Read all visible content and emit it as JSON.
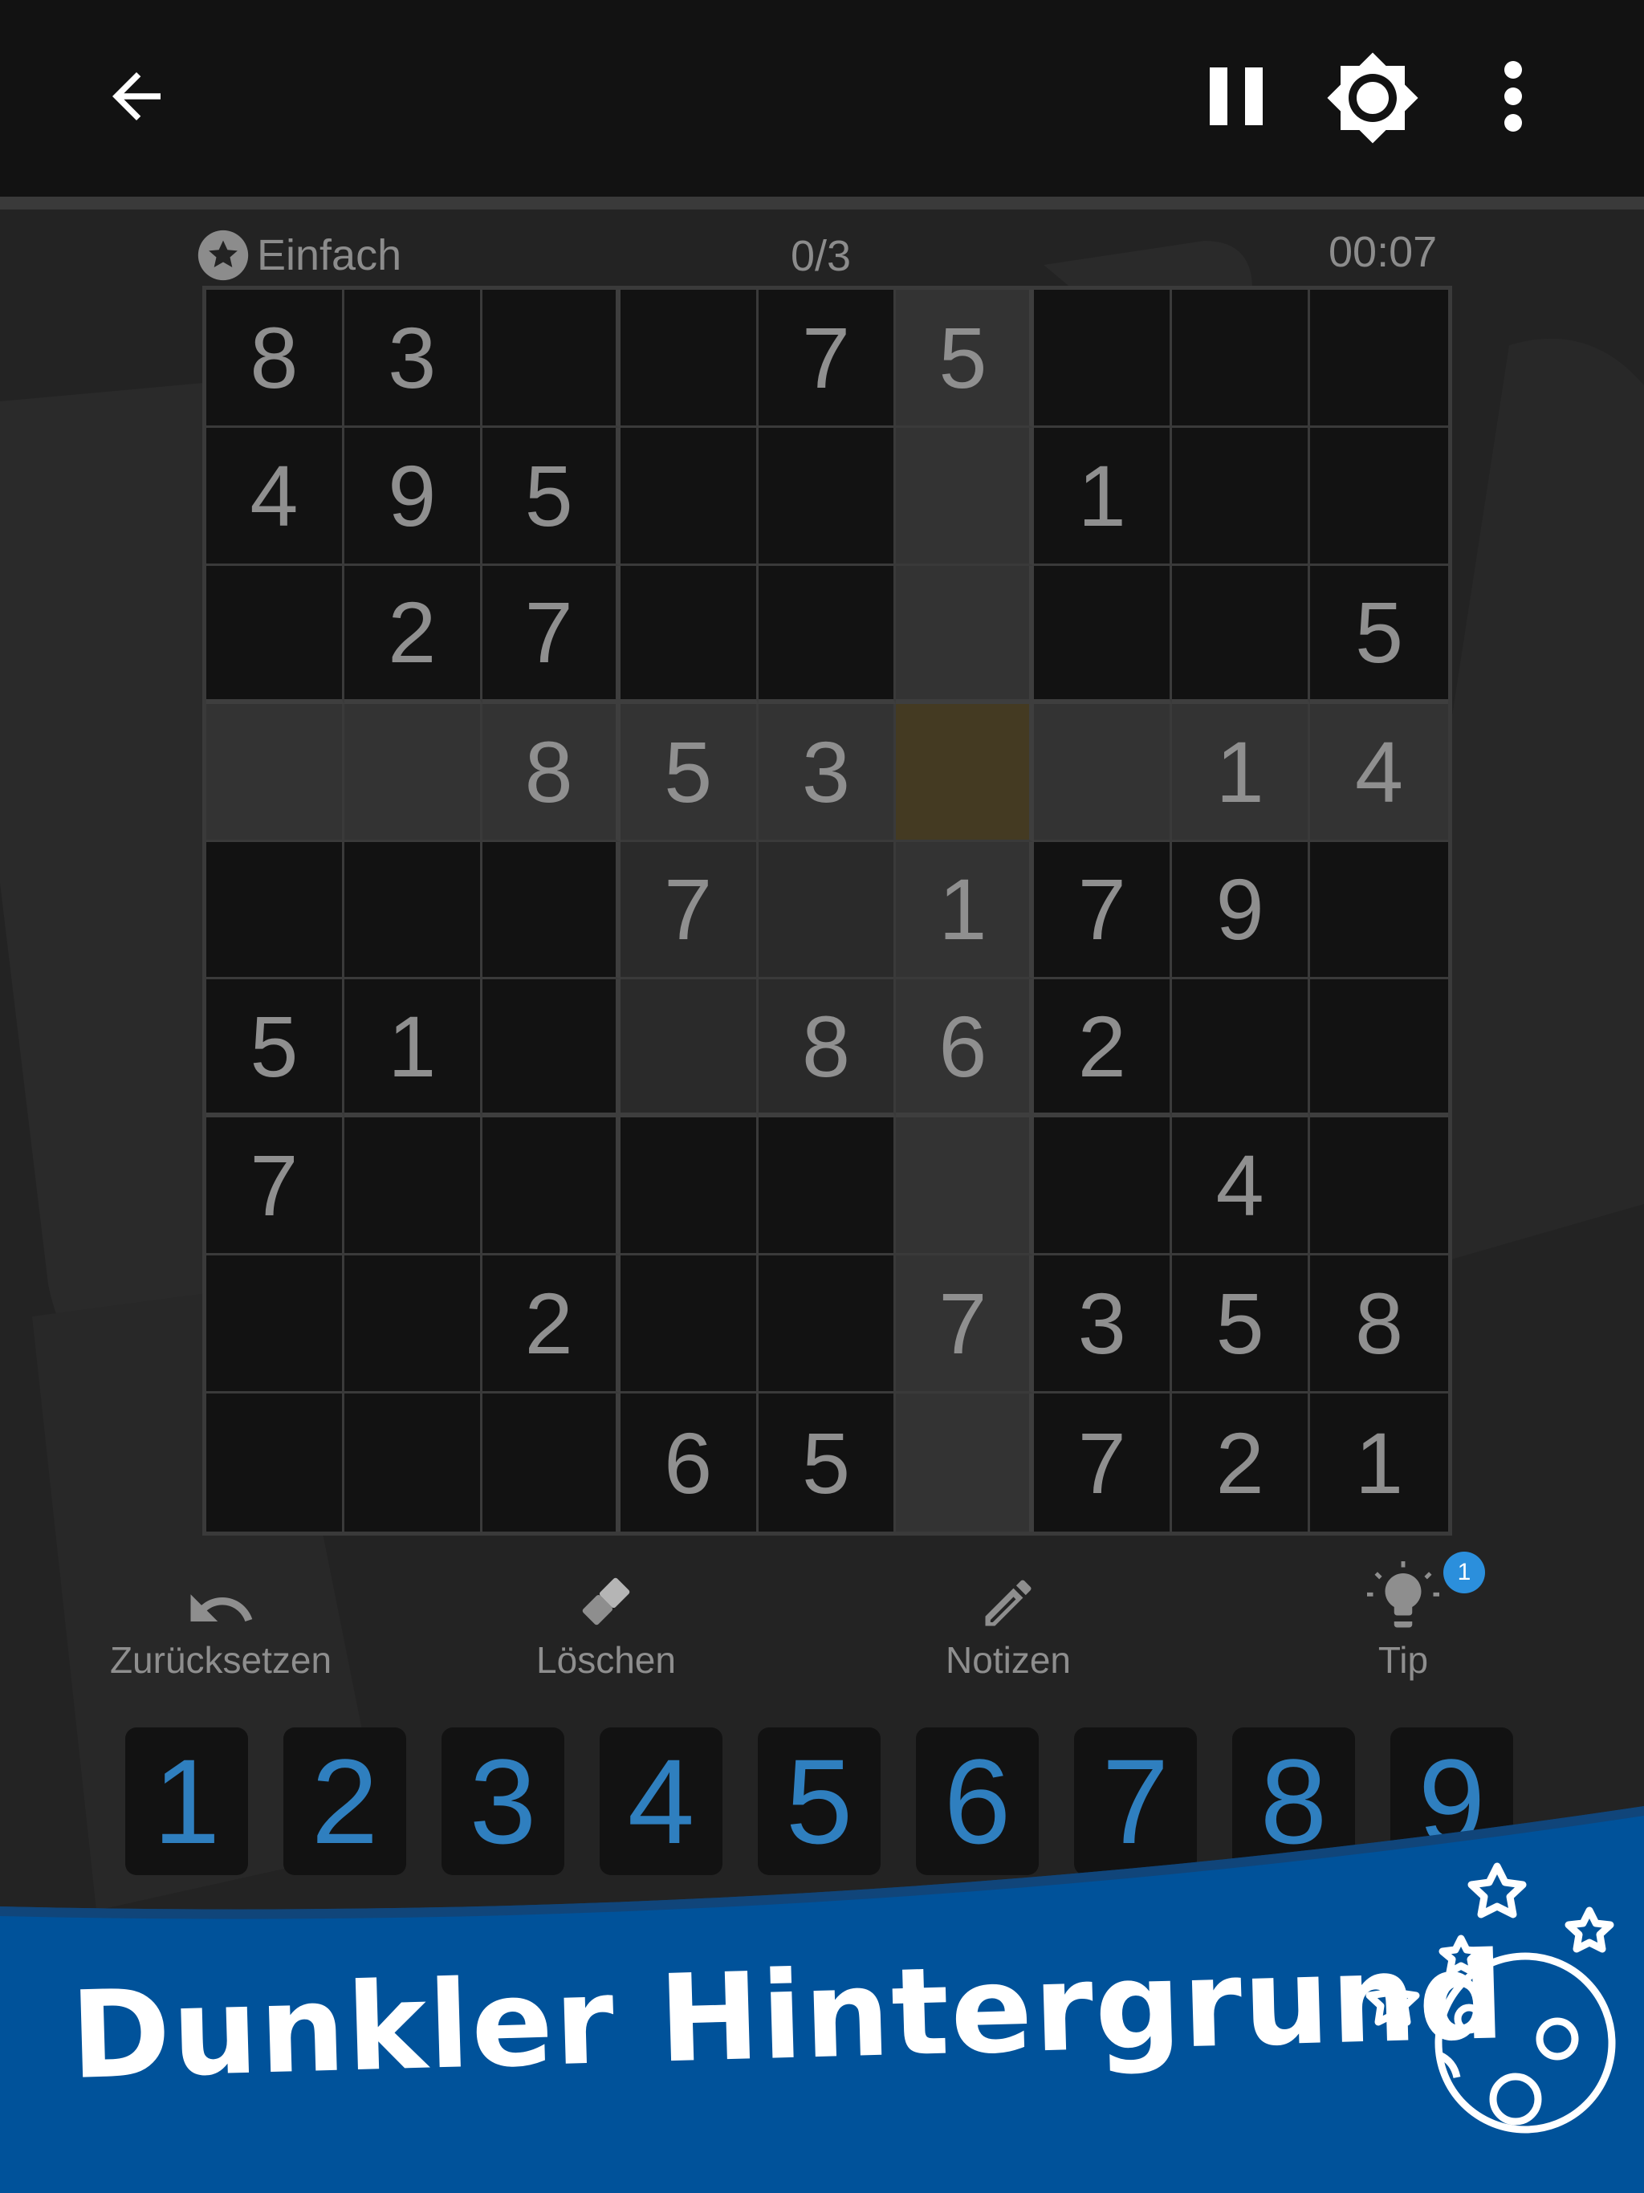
{
  "header": {
    "back_icon": "arrow-left-icon",
    "pause_icon": "pause-icon",
    "brightness_icon": "brightness-icon",
    "menu_icon": "more-vert-icon"
  },
  "info": {
    "difficulty": "Einfach",
    "difficulty_icon": "star-circle-icon",
    "mistakes": "0/3",
    "timer": "00:07"
  },
  "board": {
    "rows": [
      [
        "8",
        "3",
        "",
        "",
        "7",
        "5",
        "",
        "",
        ""
      ],
      [
        "4",
        "9",
        "5",
        "",
        "",
        "",
        "1",
        "",
        ""
      ],
      [
        "",
        "2",
        "7",
        "",
        "",
        "",
        "",
        "",
        "5"
      ],
      [
        "",
        "",
        "8",
        "5",
        "3",
        "",
        "",
        "1",
        "4"
      ],
      [
        "",
        "",
        "",
        "7",
        "",
        "1",
        "7",
        "9",
        ""
      ],
      [
        "5",
        "1",
        "",
        "",
        "8",
        "6",
        "2",
        "",
        ""
      ],
      [
        "7",
        "",
        "",
        "",
        "",
        "",
        "",
        "4",
        ""
      ],
      [
        "",
        "",
        "2",
        "",
        "",
        "7",
        "3",
        "5",
        "8"
      ],
      [
        "",
        "",
        "",
        "6",
        "5",
        "",
        "7",
        "2",
        "1"
      ]
    ],
    "selected_cell": [
      3,
      5
    ],
    "selected_color": "#443a22"
  },
  "tools": {
    "undo": {
      "label": "Zurücksetzen",
      "icon": "undo-icon"
    },
    "erase": {
      "label": "Löschen",
      "icon": "eraser-icon"
    },
    "notes": {
      "label": "Notizen",
      "icon": "pencil-icon"
    },
    "hint": {
      "label": "Tip",
      "icon": "lightbulb-icon",
      "badge": "1"
    }
  },
  "numpad": [
    "1",
    "2",
    "3",
    "4",
    "5",
    "6",
    "7",
    "8",
    "9"
  ],
  "banner": {
    "title": "Dunkler Hintergrund",
    "icon": "moon-stars-icon",
    "color": "#00529a"
  }
}
